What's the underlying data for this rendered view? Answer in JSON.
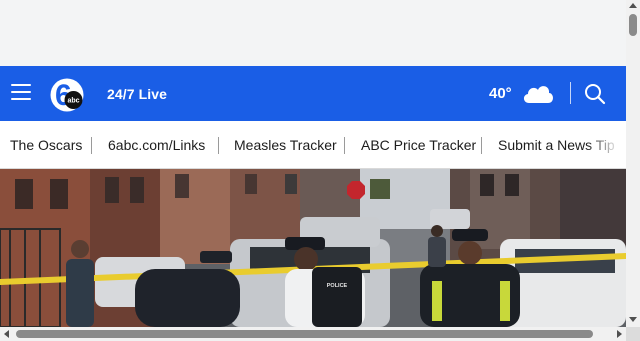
{
  "header": {
    "live_label": "24/7 Live",
    "logo_text": "abc",
    "logo_numeral": "6",
    "temperature": "40°",
    "weather_icon": "cloud-icon",
    "brand_color": "#1a5ee6"
  },
  "nav": {
    "items": [
      {
        "label": "The Oscars"
      },
      {
        "label": "6abc.com/Links"
      },
      {
        "label": "Measles Tracker"
      },
      {
        "label": "ABC Price Tracker"
      },
      {
        "label": "Submit a News Tip"
      }
    ]
  },
  "hero": {
    "vest_text": "POLICE"
  }
}
